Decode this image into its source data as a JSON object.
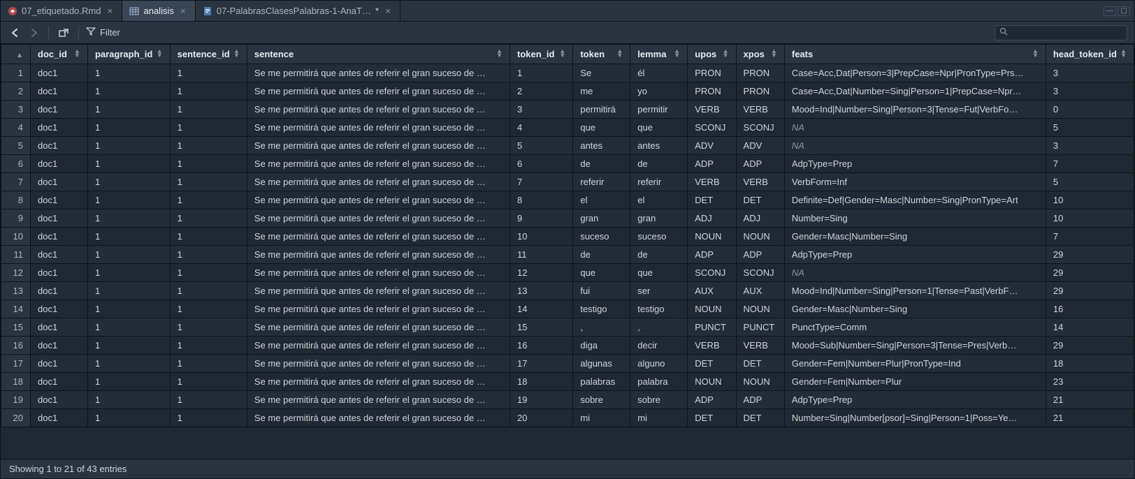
{
  "tabs": [
    {
      "label": "07_etiquetado.Rmd",
      "icon": "rmd"
    },
    {
      "label": "analisis",
      "icon": "table",
      "active": true
    },
    {
      "label": "07-PalabrasClasesPalabras-1-AnaT…",
      "icon": "doc",
      "modified": true
    }
  ],
  "toolbar": {
    "filter_label": "Filter",
    "search_placeholder": ""
  },
  "columns": [
    {
      "key": "doc_id",
      "label": "doc_id",
      "cls": "col-doc"
    },
    {
      "key": "paragraph_id",
      "label": "paragraph_id",
      "cls": "col-para"
    },
    {
      "key": "sentence_id",
      "label": "sentence_id",
      "cls": "col-sent"
    },
    {
      "key": "sentence",
      "label": "sentence",
      "cls": "col-sentence"
    },
    {
      "key": "token_id",
      "label": "token_id",
      "cls": "col-tokenid"
    },
    {
      "key": "token",
      "label": "token",
      "cls": "col-token"
    },
    {
      "key": "lemma",
      "label": "lemma",
      "cls": "col-lemma"
    },
    {
      "key": "upos",
      "label": "upos",
      "cls": "col-upos"
    },
    {
      "key": "xpos",
      "label": "xpos",
      "cls": "col-xpos"
    },
    {
      "key": "feats",
      "label": "feats",
      "cls": "col-feats"
    },
    {
      "key": "head_token_id",
      "label": "head_token_id",
      "cls": "col-head"
    }
  ],
  "rows": [
    {
      "n": 1,
      "doc_id": "doc1",
      "paragraph_id": "1",
      "sentence_id": "1",
      "sentence": "Se me permitirá que antes de referir el gran suceso de …",
      "token_id": "1",
      "token": "Se",
      "lemma": "él",
      "upos": "PRON",
      "xpos": "PRON",
      "feats": "Case=Acc,Dat|Person=3|PrepCase=Npr|PronType=Prs…",
      "head_token_id": "3"
    },
    {
      "n": 2,
      "doc_id": "doc1",
      "paragraph_id": "1",
      "sentence_id": "1",
      "sentence": "Se me permitirá que antes de referir el gran suceso de …",
      "token_id": "2",
      "token": "me",
      "lemma": "yo",
      "upos": "PRON",
      "xpos": "PRON",
      "feats": "Case=Acc,Dat|Number=Sing|Person=1|PrepCase=Npr…",
      "head_token_id": "3"
    },
    {
      "n": 3,
      "doc_id": "doc1",
      "paragraph_id": "1",
      "sentence_id": "1",
      "sentence": "Se me permitirá que antes de referir el gran suceso de …",
      "token_id": "3",
      "token": "permitirá",
      "lemma": "permitir",
      "upos": "VERB",
      "xpos": "VERB",
      "feats": "Mood=Ind|Number=Sing|Person=3|Tense=Fut|VerbFo…",
      "head_token_id": "0"
    },
    {
      "n": 4,
      "doc_id": "doc1",
      "paragraph_id": "1",
      "sentence_id": "1",
      "sentence": "Se me permitirá que antes de referir el gran suceso de …",
      "token_id": "4",
      "token": "que",
      "lemma": "que",
      "upos": "SCONJ",
      "xpos": "SCONJ",
      "feats": "NA",
      "head_token_id": "5"
    },
    {
      "n": 5,
      "doc_id": "doc1",
      "paragraph_id": "1",
      "sentence_id": "1",
      "sentence": "Se me permitirá que antes de referir el gran suceso de …",
      "token_id": "5",
      "token": "antes",
      "lemma": "antes",
      "upos": "ADV",
      "xpos": "ADV",
      "feats": "NA",
      "head_token_id": "3"
    },
    {
      "n": 6,
      "doc_id": "doc1",
      "paragraph_id": "1",
      "sentence_id": "1",
      "sentence": "Se me permitirá que antes de referir el gran suceso de …",
      "token_id": "6",
      "token": "de",
      "lemma": "de",
      "upos": "ADP",
      "xpos": "ADP",
      "feats": "AdpType=Prep",
      "head_token_id": "7"
    },
    {
      "n": 7,
      "doc_id": "doc1",
      "paragraph_id": "1",
      "sentence_id": "1",
      "sentence": "Se me permitirá que antes de referir el gran suceso de …",
      "token_id": "7",
      "token": "referir",
      "lemma": "referir",
      "upos": "VERB",
      "xpos": "VERB",
      "feats": "VerbForm=Inf",
      "head_token_id": "5"
    },
    {
      "n": 8,
      "doc_id": "doc1",
      "paragraph_id": "1",
      "sentence_id": "1",
      "sentence": "Se me permitirá que antes de referir el gran suceso de …",
      "token_id": "8",
      "token": "el",
      "lemma": "el",
      "upos": "DET",
      "xpos": "DET",
      "feats": "Definite=Def|Gender=Masc|Number=Sing|PronType=Art",
      "head_token_id": "10"
    },
    {
      "n": 9,
      "doc_id": "doc1",
      "paragraph_id": "1",
      "sentence_id": "1",
      "sentence": "Se me permitirá que antes de referir el gran suceso de …",
      "token_id": "9",
      "token": "gran",
      "lemma": "gran",
      "upos": "ADJ",
      "xpos": "ADJ",
      "feats": "Number=Sing",
      "head_token_id": "10"
    },
    {
      "n": 10,
      "doc_id": "doc1",
      "paragraph_id": "1",
      "sentence_id": "1",
      "sentence": "Se me permitirá que antes de referir el gran suceso de …",
      "token_id": "10",
      "token": "suceso",
      "lemma": "suceso",
      "upos": "NOUN",
      "xpos": "NOUN",
      "feats": "Gender=Masc|Number=Sing",
      "head_token_id": "7"
    },
    {
      "n": 11,
      "doc_id": "doc1",
      "paragraph_id": "1",
      "sentence_id": "1",
      "sentence": "Se me permitirá que antes de referir el gran suceso de …",
      "token_id": "11",
      "token": "de",
      "lemma": "de",
      "upos": "ADP",
      "xpos": "ADP",
      "feats": "AdpType=Prep",
      "head_token_id": "29"
    },
    {
      "n": 12,
      "doc_id": "doc1",
      "paragraph_id": "1",
      "sentence_id": "1",
      "sentence": "Se me permitirá que antes de referir el gran suceso de …",
      "token_id": "12",
      "token": "que",
      "lemma": "que",
      "upos": "SCONJ",
      "xpos": "SCONJ",
      "feats": "NA",
      "head_token_id": "29"
    },
    {
      "n": 13,
      "doc_id": "doc1",
      "paragraph_id": "1",
      "sentence_id": "1",
      "sentence": "Se me permitirá que antes de referir el gran suceso de …",
      "token_id": "13",
      "token": "fui",
      "lemma": "ser",
      "upos": "AUX",
      "xpos": "AUX",
      "feats": "Mood=Ind|Number=Sing|Person=1|Tense=Past|VerbF…",
      "head_token_id": "29"
    },
    {
      "n": 14,
      "doc_id": "doc1",
      "paragraph_id": "1",
      "sentence_id": "1",
      "sentence": "Se me permitirá que antes de referir el gran suceso de …",
      "token_id": "14",
      "token": "testigo",
      "lemma": "testigo",
      "upos": "NOUN",
      "xpos": "NOUN",
      "feats": "Gender=Masc|Number=Sing",
      "head_token_id": "16"
    },
    {
      "n": 15,
      "doc_id": "doc1",
      "paragraph_id": "1",
      "sentence_id": "1",
      "sentence": "Se me permitirá que antes de referir el gran suceso de …",
      "token_id": "15",
      "token": ",",
      "lemma": ",",
      "upos": "PUNCT",
      "xpos": "PUNCT",
      "feats": "PunctType=Comm",
      "head_token_id": "14"
    },
    {
      "n": 16,
      "doc_id": "doc1",
      "paragraph_id": "1",
      "sentence_id": "1",
      "sentence": "Se me permitirá que antes de referir el gran suceso de …",
      "token_id": "16",
      "token": "diga",
      "lemma": "decir",
      "upos": "VERB",
      "xpos": "VERB",
      "feats": "Mood=Sub|Number=Sing|Person=3|Tense=Pres|Verb…",
      "head_token_id": "29"
    },
    {
      "n": 17,
      "doc_id": "doc1",
      "paragraph_id": "1",
      "sentence_id": "1",
      "sentence": "Se me permitirá que antes de referir el gran suceso de …",
      "token_id": "17",
      "token": "algunas",
      "lemma": "alguno",
      "upos": "DET",
      "xpos": "DET",
      "feats": "Gender=Fem|Number=Plur|PronType=Ind",
      "head_token_id": "18"
    },
    {
      "n": 18,
      "doc_id": "doc1",
      "paragraph_id": "1",
      "sentence_id": "1",
      "sentence": "Se me permitirá que antes de referir el gran suceso de …",
      "token_id": "18",
      "token": "palabras",
      "lemma": "palabra",
      "upos": "NOUN",
      "xpos": "NOUN",
      "feats": "Gender=Fem|Number=Plur",
      "head_token_id": "23"
    },
    {
      "n": 19,
      "doc_id": "doc1",
      "paragraph_id": "1",
      "sentence_id": "1",
      "sentence": "Se me permitirá que antes de referir el gran suceso de …",
      "token_id": "19",
      "token": "sobre",
      "lemma": "sobre",
      "upos": "ADP",
      "xpos": "ADP",
      "feats": "AdpType=Prep",
      "head_token_id": "21"
    },
    {
      "n": 20,
      "doc_id": "doc1",
      "paragraph_id": "1",
      "sentence_id": "1",
      "sentence": "Se me permitirá que antes de referir el gran suceso de …",
      "token_id": "20",
      "token": "mi",
      "lemma": "mi",
      "upos": "DET",
      "xpos": "DET",
      "feats": "Number=Sing|Number[psor]=Sing|Person=1|Poss=Ye…",
      "head_token_id": "21"
    }
  ],
  "status": {
    "text": "Showing 1 to 21 of 43 entries"
  }
}
